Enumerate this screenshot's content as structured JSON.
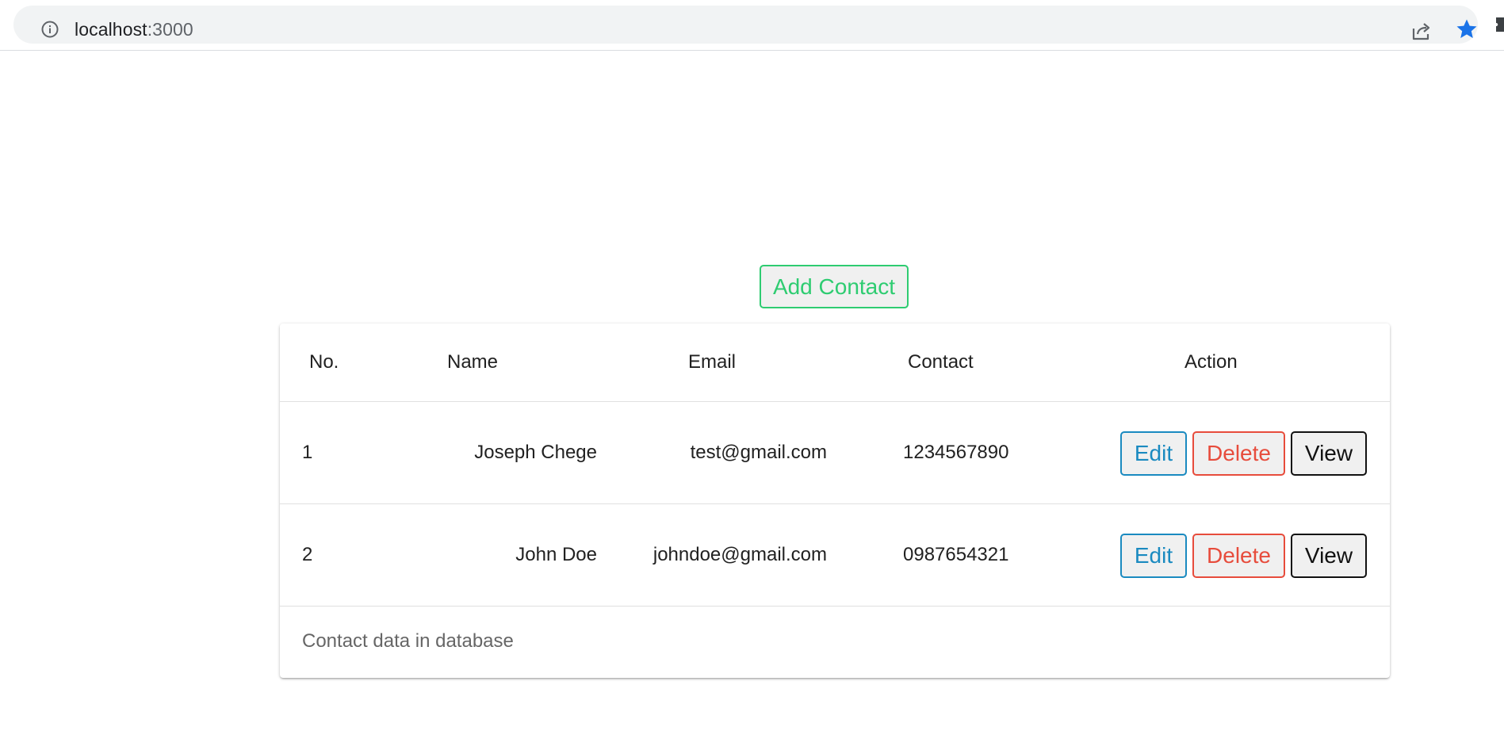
{
  "browser": {
    "url_host": "localhost",
    "url_port": ":3000",
    "icons": [
      "site-info-icon",
      "share-icon",
      "star-icon",
      "extension-icon"
    ],
    "star_color": "#1a73e8"
  },
  "page": {
    "add_contact_label": "Add Contact",
    "table": {
      "headers": [
        "No.",
        "Name",
        "Email",
        "Contact",
        "Action"
      ],
      "rows": [
        {
          "no": "1",
          "name": "Joseph Chege",
          "email": "test@gmail.com",
          "contact": "1234567890"
        },
        {
          "no": "2",
          "name": "John Doe",
          "email": "johndoe@gmail.com",
          "contact": "0987654321"
        }
      ],
      "actions": {
        "edit": "Edit",
        "delete": "Delete",
        "view": "View"
      },
      "caption": "Contact data in database"
    },
    "colors": {
      "add": "#2ecc71",
      "edit": "#1a8ac0",
      "delete": "#e74c3c",
      "view": "#111111"
    }
  }
}
